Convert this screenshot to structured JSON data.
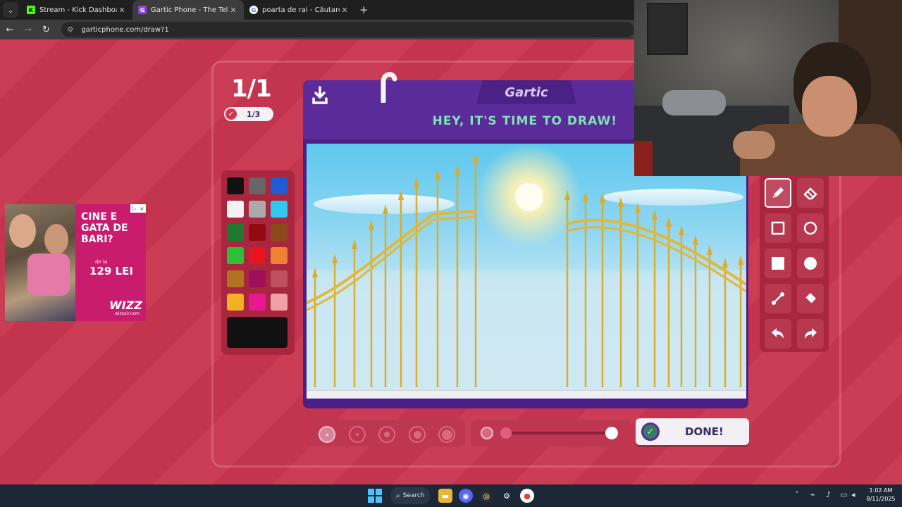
{
  "browser": {
    "tabs": [
      {
        "title": "Stream - Kick Dashboard",
        "favicon": "kick-icon",
        "active": false
      },
      {
        "title": "Gartic Phone - The Telephone G",
        "favicon": "gartic-icon",
        "active": true
      },
      {
        "title": "poarta de rai - Căutare Google",
        "favicon": "google-icon",
        "active": false
      }
    ],
    "new_tab_label": "+",
    "url": "garticphone.com/draw?1"
  },
  "game": {
    "round": "1/1",
    "progress": "1/3",
    "logo": "Gartic",
    "prompt": "HEY, IT'S TIME TO DRAW!",
    "done_label": "DONE!",
    "selected_tool": "pencil",
    "current_color": "#111111",
    "palette": [
      "#111111",
      "#666666",
      "#1f5bd1",
      "#f2f2f2",
      "#aaaaaa",
      "#2fc8ef",
      "#1e7a2e",
      "#900a0f",
      "#8c4a1c",
      "#2ebf3a",
      "#e8141e",
      "#f08032",
      "#b07420",
      "#a0105a",
      "#c05060",
      "#f3b020",
      "#e81890",
      "#f2a0a8"
    ],
    "brush_sizes": 5,
    "selected_brush_size": 1,
    "opacity": 1.0,
    "tools": [
      "pencil-icon",
      "eraser-icon",
      "rectangle-outline-icon",
      "circle-outline-icon",
      "rectangle-fill-icon",
      "circle-fill-icon",
      "line-icon",
      "bucket-icon",
      "undo-icon",
      "redo-icon"
    ]
  },
  "ad": {
    "title": "CINE E GATA DE BARI?",
    "from": "de la",
    "price": "129 LEI",
    "brand": "WIZZ",
    "domain": "wizzair.com",
    "badge_icons": [
      "adchoices-icon",
      "close-icon"
    ]
  },
  "taskbar": {
    "search_label": "Search",
    "time": "1:02 AM",
    "date": "8/11/2025"
  }
}
